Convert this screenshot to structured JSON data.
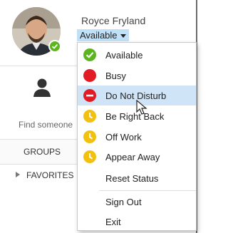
{
  "user": {
    "name": "Royce Fryland",
    "status": "Available"
  },
  "search": {
    "placeholder": "Find someone"
  },
  "groups": {
    "label": "GROUPS"
  },
  "favorites": {
    "label": "FAVORITES"
  },
  "status_menu": {
    "items": [
      {
        "label": "Available",
        "icon": "available-icon",
        "color": "#5cb51f"
      },
      {
        "label": "Busy",
        "icon": "busy-icon",
        "color": "#e11c25"
      },
      {
        "label": "Do Not Disturb",
        "icon": "do-not-disturb-icon",
        "color": "#e11c25"
      },
      {
        "label": "Be Right Back",
        "icon": "clock-icon",
        "color": "#f2c10f"
      },
      {
        "label": "Off Work",
        "icon": "clock-icon",
        "color": "#f2c10f"
      },
      {
        "label": "Appear Away",
        "icon": "clock-icon",
        "color": "#f2c10f"
      },
      {
        "label": "Reset Status"
      },
      {
        "label": "Sign Out"
      },
      {
        "label": "Exit"
      }
    ]
  }
}
